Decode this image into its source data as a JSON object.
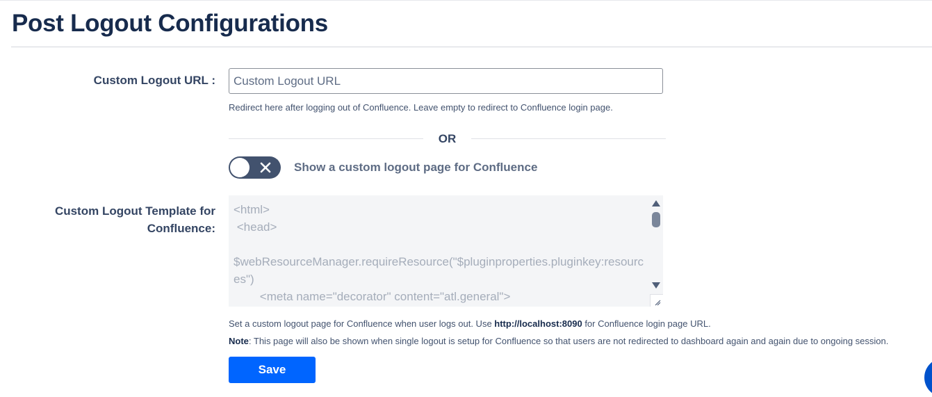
{
  "page": {
    "title": "Post Logout Configurations"
  },
  "custom_logout_url": {
    "label": "Custom Logout URL :",
    "value": "",
    "placeholder": "Custom Logout URL",
    "help": "Redirect here after logging out of Confluence. Leave empty to redirect to Confluence login page."
  },
  "divider": {
    "or_text": "OR"
  },
  "toggle": {
    "state": "off",
    "icon": "close-icon",
    "label": "Show a custom logout page for Confluence"
  },
  "template": {
    "label_line1": "Custom Logout Template for",
    "label_line2": "Confluence:",
    "content": "<html>\n <head>\n\n$webResourceManager.requireResource(\"$pluginproperties.pluginkey:resources\")\n        <meta name=\"decorator\" content=\"atl.general\">",
    "help_prefix": "Set a custom logout page for Confluence when user logs out. Use ",
    "help_url": "http://localhost:8090",
    "help_suffix": " for Confluence login page URL.",
    "note_label": "Note",
    "note_text": ": This page will also be shown when single logout is setup for Confluence so that users are not redirected to dashboard again and again due to ongoing session."
  },
  "actions": {
    "save_label": "Save"
  },
  "colors": {
    "primary": "#0065ff",
    "title": "#172b4d",
    "toggle_off": "#42526e",
    "template_bg": "#f4f5f7"
  }
}
